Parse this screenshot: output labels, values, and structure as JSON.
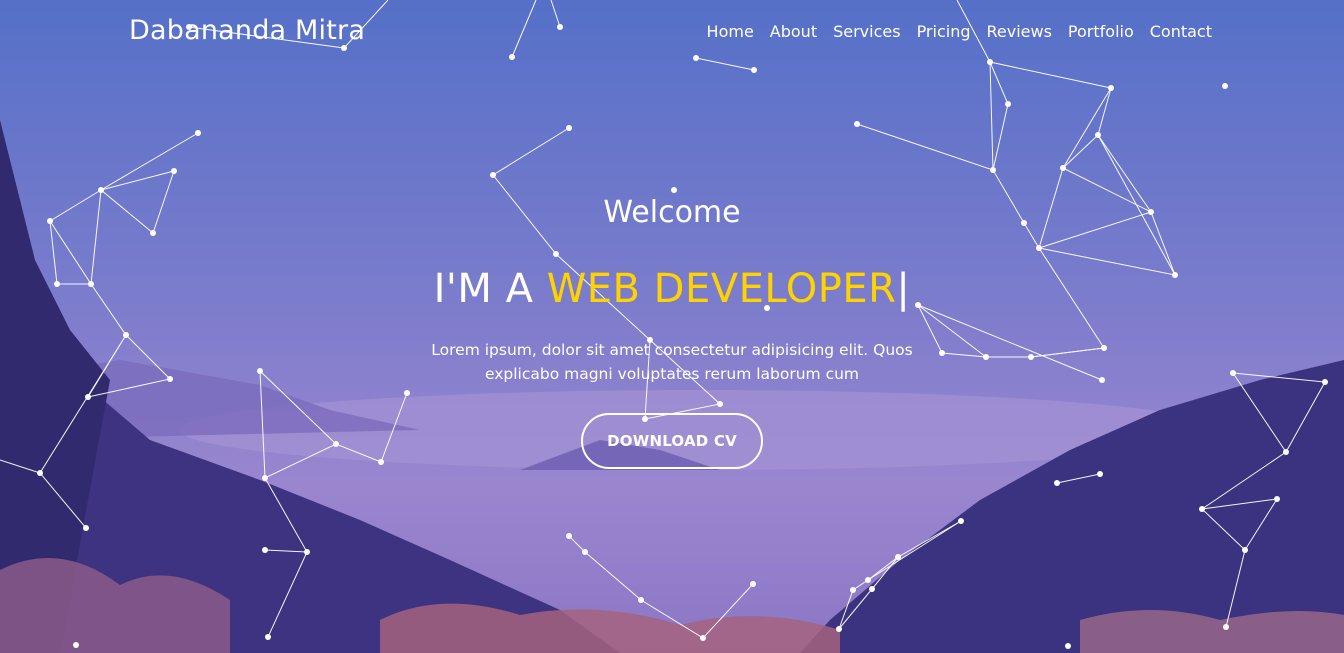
{
  "brand": {
    "name": "Dabananda Mitra"
  },
  "nav": {
    "items": [
      "Home",
      "About",
      "Services",
      "Pricing",
      "Reviews",
      "Portfolio",
      "Contact"
    ]
  },
  "hero": {
    "welcome": "Welcome",
    "prefix": "I'M A ",
    "role": "WEB DEVELOPER",
    "cursor": "|",
    "lead": "Lorem ipsum, dolor sit amet consectetur adipisicing elit. Quos explicabo magni voluptates rerum laborum cum",
    "cta": "DOWNLOAD CV"
  },
  "colors": {
    "accent": "#ffd200",
    "sky_top": "#5b71c9",
    "sky_mid": "#8f7ac8",
    "mountain_dark": "#3f3583"
  },
  "icons": {
    "background": "mountain-landscape-photo",
    "overlay": "particle-network"
  }
}
